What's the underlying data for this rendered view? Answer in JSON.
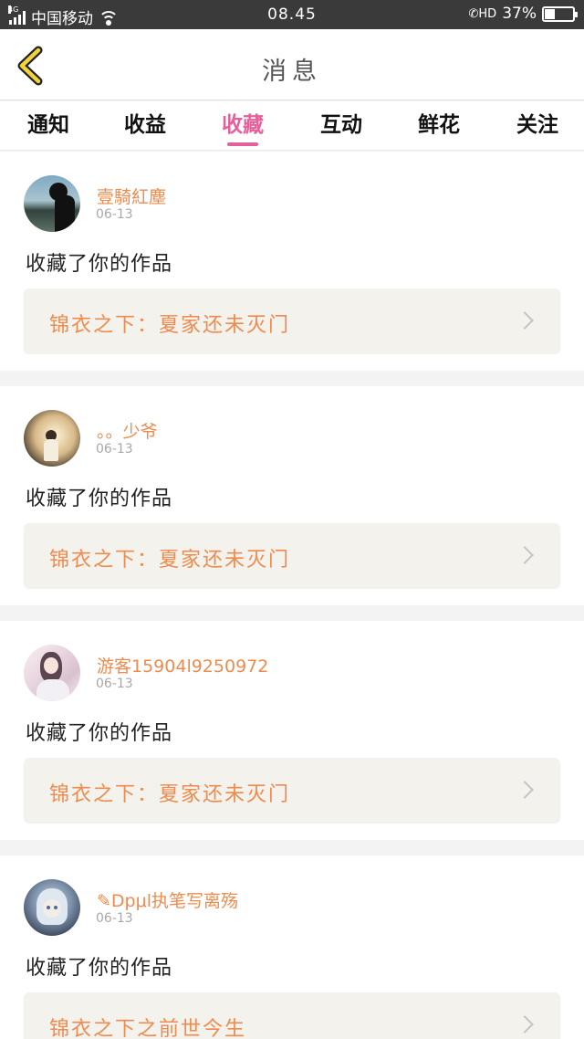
{
  "status_bar": {
    "network": "4G",
    "carrier": "中国移动",
    "time": "08.45",
    "hd": "HD",
    "battery": "37%",
    "battery_level": 0.37
  },
  "nav": {
    "title": "消息"
  },
  "tabs": [
    {
      "label": "通知",
      "active": false
    },
    {
      "label": "收益",
      "active": false
    },
    {
      "label": "收藏",
      "active": true
    },
    {
      "label": "互动",
      "active": false
    },
    {
      "label": "鲜花",
      "active": false
    },
    {
      "label": "关注",
      "active": false
    }
  ],
  "colors": {
    "accent": "#e5609a",
    "username": "#ee8b4e",
    "card_link_bg": "#f3f2ed"
  },
  "messages": [
    {
      "username": "壹騎紅塵",
      "date": "06-13",
      "text": "收藏了你的作品",
      "work_title": "锦衣之下：夏家还未灭门"
    },
    {
      "username": "。。少爷",
      "date": "06-13",
      "text": "收藏了你的作品",
      "work_title": "锦衣之下：夏家还未灭门"
    },
    {
      "username": "游客15904l9250972",
      "date": "06-13",
      "text": "收藏了你的作品",
      "work_title": "锦衣之下：夏家还未灭门"
    },
    {
      "username": "✎Dpμl执笔写离殇",
      "date": "06-13",
      "text": "收藏了你的作品",
      "work_title": "锦衣之下之前世今生"
    }
  ]
}
